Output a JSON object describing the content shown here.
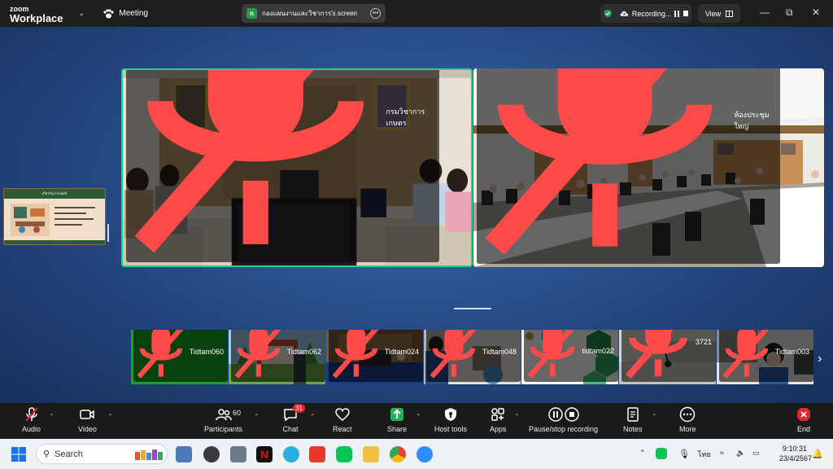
{
  "app": {
    "logo_line1": "zoom",
    "logo_line2": "Workplace",
    "meeting_label": "Meeting"
  },
  "share_banner": {
    "badge_letter": "n",
    "label": "กองแผนงานและวิชาการ's screen"
  },
  "recording": {
    "label": "Recording..."
  },
  "view_label": "View",
  "slide_thumbnail": {
    "title": "เกี่ยวกับเราเกษตรี"
  },
  "main_videos": [
    {
      "name": "กรมวิชาการเกษตร"
    },
    {
      "name": "ห้องประชุมใหญ่"
    }
  ],
  "participant_tiles": [
    {
      "name": "Tidtam060"
    },
    {
      "name": "Tidtam062"
    },
    {
      "name": "Tidtam024"
    },
    {
      "name": "Tidtam048"
    },
    {
      "name": "tidtam022"
    },
    {
      "name": "3721"
    },
    {
      "name": "Tidtam003"
    }
  ],
  "toolbar": {
    "audio": "Audio",
    "video": "Video",
    "participants": "Participants",
    "participants_count": "60",
    "chat": "Chat",
    "chat_badge": "31",
    "react": "React",
    "share": "Share",
    "host_tools": "Host tools",
    "apps": "Apps",
    "pause_stop": "Pause/stop recording",
    "notes": "Notes",
    "more": "More",
    "end": "End"
  },
  "taskbar": {
    "search_placeholder": "Search",
    "language": "ไทย",
    "time": "9:10:31",
    "date": "23/4/2567"
  },
  "colors": {
    "active_speaker_border": "#23d18b",
    "share_green": "#1f9d4a",
    "end_red": "#e0262d",
    "stage_blue": "#294f8d"
  }
}
